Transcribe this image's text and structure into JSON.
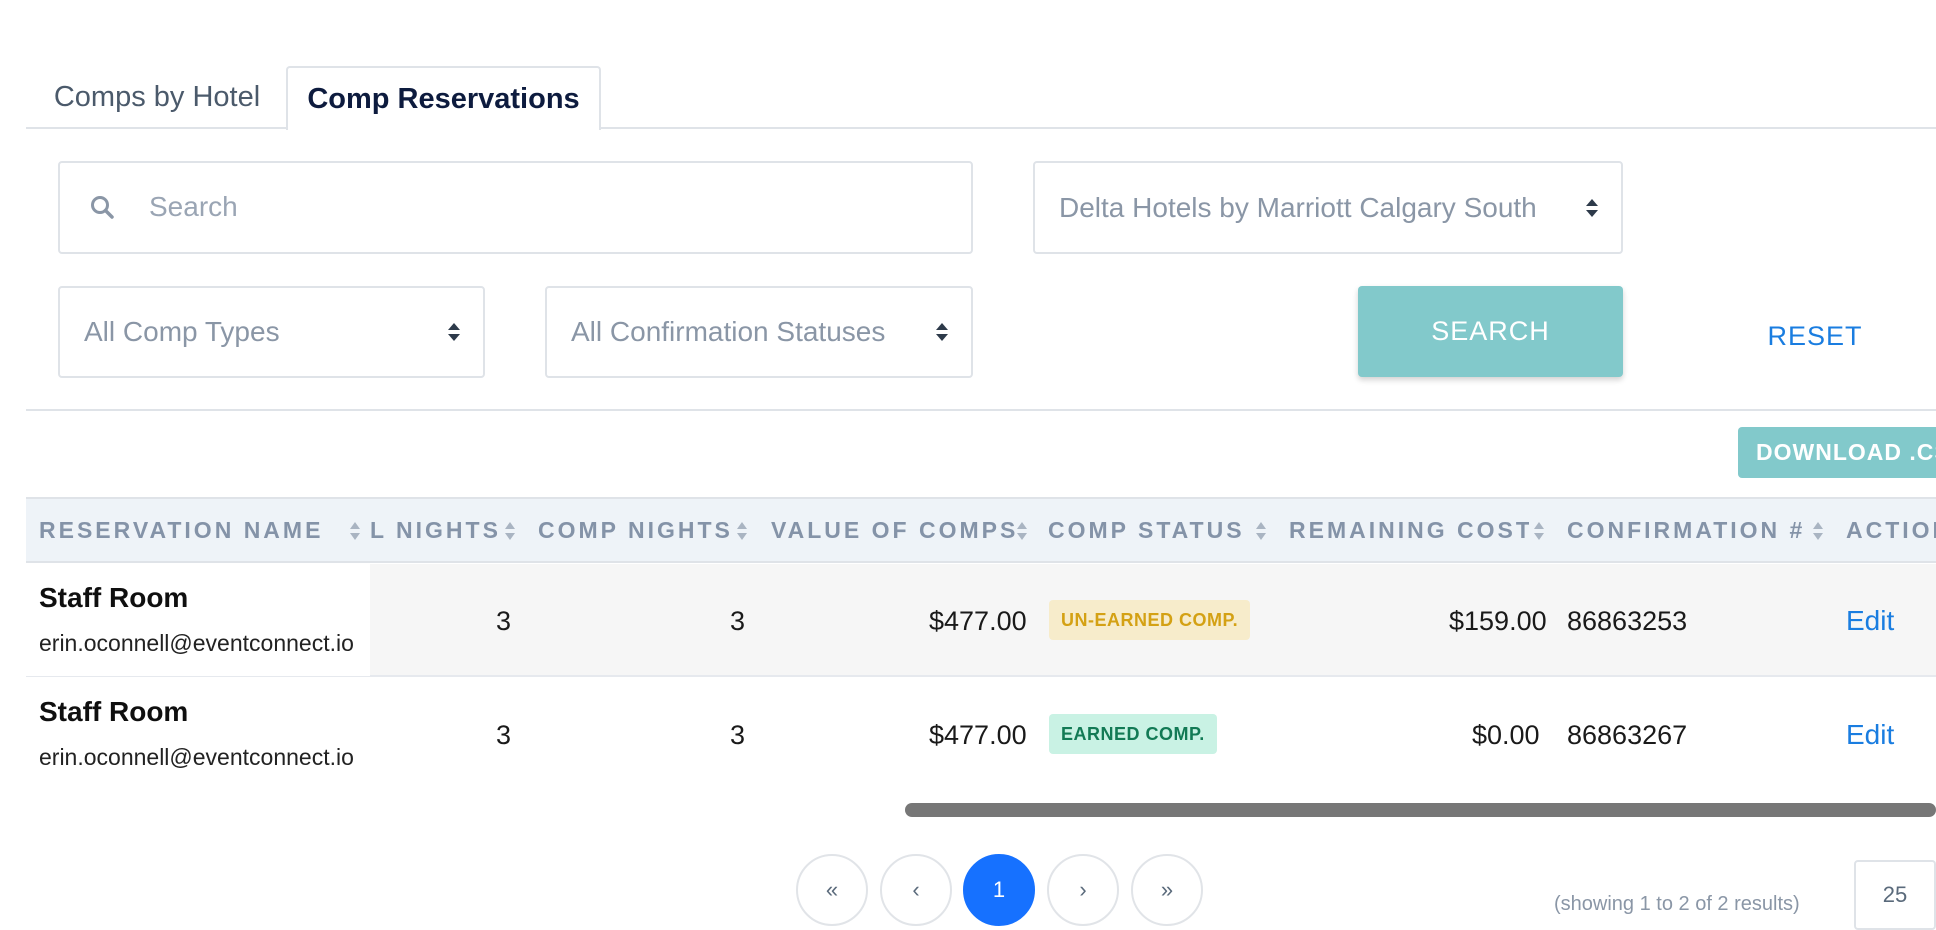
{
  "tabs": [
    {
      "label": "Comps by Hotel",
      "active": false
    },
    {
      "label": "Comp Reservations",
      "active": true
    }
  ],
  "filters": {
    "search_placeholder": "Search",
    "hotel_selected": "Delta Hotels by Marriott Calgary South",
    "comp_type_selected": "All Comp Types",
    "confirmation_status_selected": "All Confirmation Statuses",
    "search_button": "SEARCH",
    "reset_link": "RESET"
  },
  "download_button": "DOWNLOAD .CS",
  "table": {
    "columns": [
      "RESERVATION NAME",
      "L NIGHTS",
      "COMP NIGHTS",
      "VALUE OF COMPS",
      "COMP STATUS",
      "REMAINING COST",
      "CONFIRMATION #",
      "ACTION"
    ],
    "rows": [
      {
        "name": "Staff Room",
        "email": "erin.oconnell@eventconnect.io",
        "total_nights": "3",
        "comp_nights": "3",
        "value_of_comps": "$477.00",
        "comp_status": "UN-EARNED COMP.",
        "remaining_cost": "$159.00",
        "confirmation": "86863253",
        "action": "Edit"
      },
      {
        "name": "Staff Room",
        "email": "erin.oconnell@eventconnect.io",
        "total_nights": "3",
        "comp_nights": "3",
        "value_of_comps": "$477.00",
        "comp_status": "EARNED COMP.",
        "remaining_cost": "$0.00",
        "confirmation": "86863267",
        "action": "Edit"
      }
    ]
  },
  "pagination": {
    "first": "«",
    "prev": "‹",
    "current": "1",
    "next": "›",
    "last": "»",
    "showing": "(showing 1 to 2 of 2 results)",
    "per_page": "25"
  },
  "colors": {
    "accent_teal": "#82c9cb",
    "link_blue": "#1a7de0",
    "page_active": "#1671ff"
  }
}
